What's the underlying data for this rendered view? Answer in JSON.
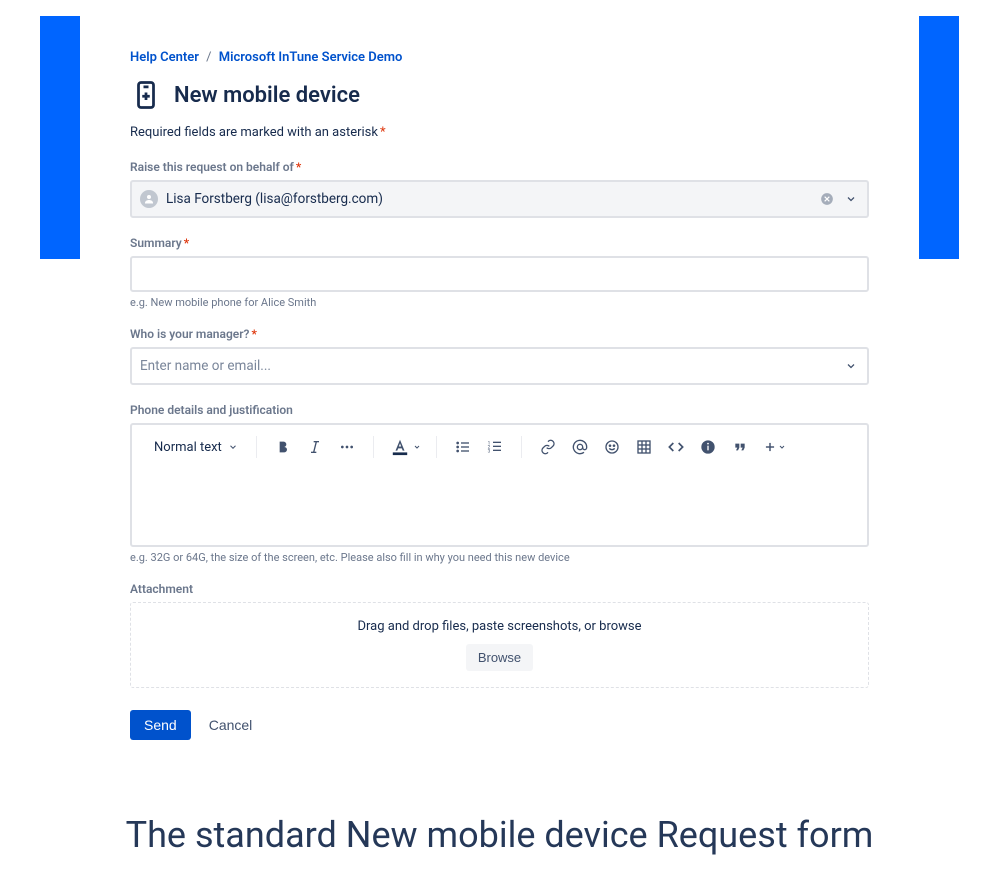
{
  "breadcrumb": {
    "help_center": "Help Center",
    "service": "Microsoft InTune Service Demo"
  },
  "title": "New mobile device",
  "required_note": "Required fields are marked with an asterisk",
  "fields": {
    "requester": {
      "label": "Raise this request on behalf of",
      "value": "Lisa Forstberg (lisa@forstberg.com)"
    },
    "summary": {
      "label": "Summary",
      "value": "",
      "hint": "e.g. New mobile phone for Alice Smith"
    },
    "manager": {
      "label": "Who is your manager?",
      "placeholder": "Enter name or email...",
      "value": ""
    },
    "details": {
      "label": "Phone details and justification",
      "heading_style": "Normal text",
      "hint": "e.g. 32G or 64G, the size of the screen, etc. Please also fill in why you need this new device"
    },
    "attachment": {
      "label": "Attachment",
      "dropzone_text": "Drag and drop files, paste screenshots, or browse",
      "browse_label": "Browse"
    }
  },
  "actions": {
    "send": "Send",
    "cancel": "Cancel"
  },
  "caption": "The standard New mobile device Request form"
}
